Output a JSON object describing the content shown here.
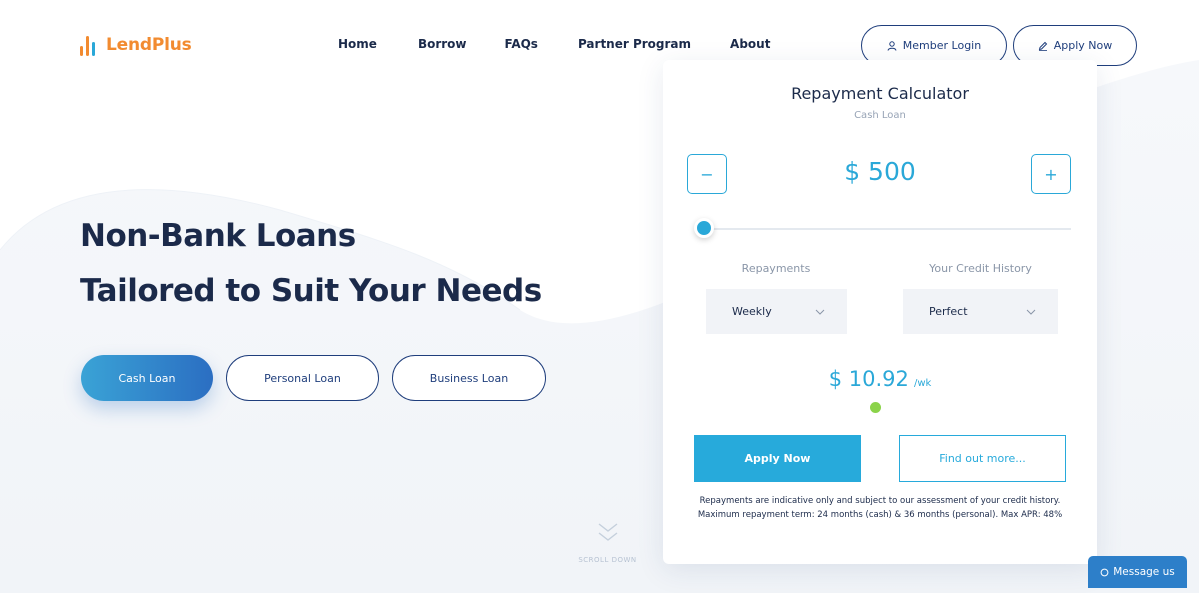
{
  "brand": {
    "name": "LendPlus",
    "colors": {
      "orange": "#f28b30",
      "blue": "#2aa8d8",
      "navy": "#1b2a4a"
    }
  },
  "nav": {
    "items": [
      "Home",
      "Borrow",
      "FAQs",
      "Partner Program",
      "About"
    ]
  },
  "header": {
    "member_login": {
      "label": "Member Login",
      "icon": "user-icon"
    },
    "apply_now": {
      "label": "Apply Now",
      "icon": "edit-icon"
    }
  },
  "hero": {
    "title_line1": "Non-Bank Loans",
    "title_line2": "Tailored to Suit Your Needs",
    "loan_types": [
      {
        "label": "Cash Loan",
        "active": true
      },
      {
        "label": "Personal Loan",
        "active": false
      },
      {
        "label": "Business Loan",
        "active": false
      }
    ],
    "scroll_label": "SCROLL DOWN"
  },
  "calculator": {
    "title": "Repayment Calculator",
    "subtitle": "Cash Loan",
    "minus_label": "−",
    "plus_label": "+",
    "amount": "$ 500",
    "slider_fraction": 0.0,
    "repayments_label": "Repayments",
    "repayments_value": "Weekly",
    "credit_label": "Your Credit History",
    "credit_value": "Perfect",
    "result_amount": "$ 10.92",
    "result_period": "/wk",
    "apply_label": "Apply Now",
    "find_out_label": "Find out more...",
    "disclaimer": "Repayments are indicative only and subject to our assessment of your credit history. Maximum repayment term: 24 months (cash) & 36 months (personal). Max APR: 48%"
  },
  "chat": {
    "label": "Message us",
    "icon": "chat-icon"
  }
}
